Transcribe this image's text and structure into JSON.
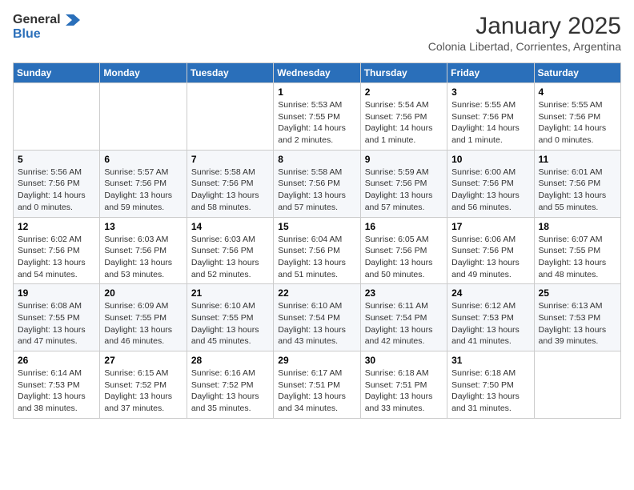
{
  "header": {
    "logo_general": "General",
    "logo_blue": "Blue",
    "month_title": "January 2025",
    "subtitle": "Colonia Libertad, Corrientes, Argentina"
  },
  "weekdays": [
    "Sunday",
    "Monday",
    "Tuesday",
    "Wednesday",
    "Thursday",
    "Friday",
    "Saturday"
  ],
  "weeks": [
    [
      {
        "day": "",
        "sunrise": "",
        "sunset": "",
        "daylight": ""
      },
      {
        "day": "",
        "sunrise": "",
        "sunset": "",
        "daylight": ""
      },
      {
        "day": "",
        "sunrise": "",
        "sunset": "",
        "daylight": ""
      },
      {
        "day": "1",
        "sunrise": "Sunrise: 5:53 AM",
        "sunset": "Sunset: 7:55 PM",
        "daylight": "Daylight: 14 hours and 2 minutes."
      },
      {
        "day": "2",
        "sunrise": "Sunrise: 5:54 AM",
        "sunset": "Sunset: 7:56 PM",
        "daylight": "Daylight: 14 hours and 1 minute."
      },
      {
        "day": "3",
        "sunrise": "Sunrise: 5:55 AM",
        "sunset": "Sunset: 7:56 PM",
        "daylight": "Daylight: 14 hours and 1 minute."
      },
      {
        "day": "4",
        "sunrise": "Sunrise: 5:55 AM",
        "sunset": "Sunset: 7:56 PM",
        "daylight": "Daylight: 14 hours and 0 minutes."
      }
    ],
    [
      {
        "day": "5",
        "sunrise": "Sunrise: 5:56 AM",
        "sunset": "Sunset: 7:56 PM",
        "daylight": "Daylight: 14 hours and 0 minutes."
      },
      {
        "day": "6",
        "sunrise": "Sunrise: 5:57 AM",
        "sunset": "Sunset: 7:56 PM",
        "daylight": "Daylight: 13 hours and 59 minutes."
      },
      {
        "day": "7",
        "sunrise": "Sunrise: 5:58 AM",
        "sunset": "Sunset: 7:56 PM",
        "daylight": "Daylight: 13 hours and 58 minutes."
      },
      {
        "day": "8",
        "sunrise": "Sunrise: 5:58 AM",
        "sunset": "Sunset: 7:56 PM",
        "daylight": "Daylight: 13 hours and 57 minutes."
      },
      {
        "day": "9",
        "sunrise": "Sunrise: 5:59 AM",
        "sunset": "Sunset: 7:56 PM",
        "daylight": "Daylight: 13 hours and 57 minutes."
      },
      {
        "day": "10",
        "sunrise": "Sunrise: 6:00 AM",
        "sunset": "Sunset: 7:56 PM",
        "daylight": "Daylight: 13 hours and 56 minutes."
      },
      {
        "day": "11",
        "sunrise": "Sunrise: 6:01 AM",
        "sunset": "Sunset: 7:56 PM",
        "daylight": "Daylight: 13 hours and 55 minutes."
      }
    ],
    [
      {
        "day": "12",
        "sunrise": "Sunrise: 6:02 AM",
        "sunset": "Sunset: 7:56 PM",
        "daylight": "Daylight: 13 hours and 54 minutes."
      },
      {
        "day": "13",
        "sunrise": "Sunrise: 6:03 AM",
        "sunset": "Sunset: 7:56 PM",
        "daylight": "Daylight: 13 hours and 53 minutes."
      },
      {
        "day": "14",
        "sunrise": "Sunrise: 6:03 AM",
        "sunset": "Sunset: 7:56 PM",
        "daylight": "Daylight: 13 hours and 52 minutes."
      },
      {
        "day": "15",
        "sunrise": "Sunrise: 6:04 AM",
        "sunset": "Sunset: 7:56 PM",
        "daylight": "Daylight: 13 hours and 51 minutes."
      },
      {
        "day": "16",
        "sunrise": "Sunrise: 6:05 AM",
        "sunset": "Sunset: 7:56 PM",
        "daylight": "Daylight: 13 hours and 50 minutes."
      },
      {
        "day": "17",
        "sunrise": "Sunrise: 6:06 AM",
        "sunset": "Sunset: 7:56 PM",
        "daylight": "Daylight: 13 hours and 49 minutes."
      },
      {
        "day": "18",
        "sunrise": "Sunrise: 6:07 AM",
        "sunset": "Sunset: 7:55 PM",
        "daylight": "Daylight: 13 hours and 48 minutes."
      }
    ],
    [
      {
        "day": "19",
        "sunrise": "Sunrise: 6:08 AM",
        "sunset": "Sunset: 7:55 PM",
        "daylight": "Daylight: 13 hours and 47 minutes."
      },
      {
        "day": "20",
        "sunrise": "Sunrise: 6:09 AM",
        "sunset": "Sunset: 7:55 PM",
        "daylight": "Daylight: 13 hours and 46 minutes."
      },
      {
        "day": "21",
        "sunrise": "Sunrise: 6:10 AM",
        "sunset": "Sunset: 7:55 PM",
        "daylight": "Daylight: 13 hours and 45 minutes."
      },
      {
        "day": "22",
        "sunrise": "Sunrise: 6:10 AM",
        "sunset": "Sunset: 7:54 PM",
        "daylight": "Daylight: 13 hours and 43 minutes."
      },
      {
        "day": "23",
        "sunrise": "Sunrise: 6:11 AM",
        "sunset": "Sunset: 7:54 PM",
        "daylight": "Daylight: 13 hours and 42 minutes."
      },
      {
        "day": "24",
        "sunrise": "Sunrise: 6:12 AM",
        "sunset": "Sunset: 7:53 PM",
        "daylight": "Daylight: 13 hours and 41 minutes."
      },
      {
        "day": "25",
        "sunrise": "Sunrise: 6:13 AM",
        "sunset": "Sunset: 7:53 PM",
        "daylight": "Daylight: 13 hours and 39 minutes."
      }
    ],
    [
      {
        "day": "26",
        "sunrise": "Sunrise: 6:14 AM",
        "sunset": "Sunset: 7:53 PM",
        "daylight": "Daylight: 13 hours and 38 minutes."
      },
      {
        "day": "27",
        "sunrise": "Sunrise: 6:15 AM",
        "sunset": "Sunset: 7:52 PM",
        "daylight": "Daylight: 13 hours and 37 minutes."
      },
      {
        "day": "28",
        "sunrise": "Sunrise: 6:16 AM",
        "sunset": "Sunset: 7:52 PM",
        "daylight": "Daylight: 13 hours and 35 minutes."
      },
      {
        "day": "29",
        "sunrise": "Sunrise: 6:17 AM",
        "sunset": "Sunset: 7:51 PM",
        "daylight": "Daylight: 13 hours and 34 minutes."
      },
      {
        "day": "30",
        "sunrise": "Sunrise: 6:18 AM",
        "sunset": "Sunset: 7:51 PM",
        "daylight": "Daylight: 13 hours and 33 minutes."
      },
      {
        "day": "31",
        "sunrise": "Sunrise: 6:18 AM",
        "sunset": "Sunset: 7:50 PM",
        "daylight": "Daylight: 13 hours and 31 minutes."
      },
      {
        "day": "",
        "sunrise": "",
        "sunset": "",
        "daylight": ""
      }
    ]
  ]
}
